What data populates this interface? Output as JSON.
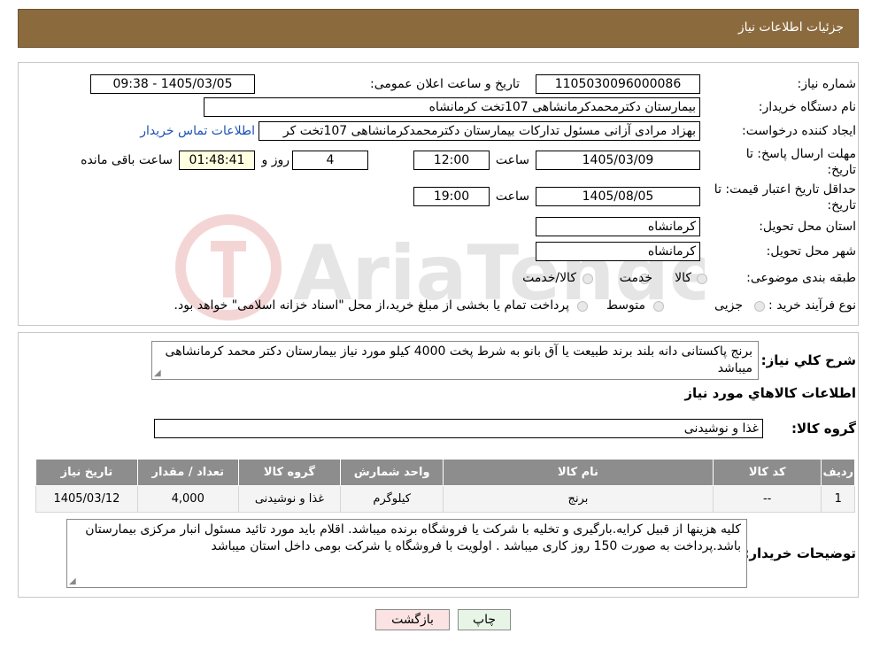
{
  "header": {
    "title": "جزئیات اطلاعات نیاز"
  },
  "form": {
    "need_number_label": "شماره نیاز:",
    "need_number": "1105030096000086",
    "announce_label": "تاریخ و ساعت اعلان عمومی:",
    "announce_value": "1405/03/05 - 09:38",
    "buyer_label": "نام دستگاه خریدار:",
    "buyer_value": "بیمارستان دکترمحمدکرمانشاهی 107تخت کرمانشاه",
    "creator_label": "ایجاد کننده درخواست:",
    "creator_value": "بهزاد مرادی آزانی مسئول تدارکات بیمارستان دکترمحمدکرمانشاهی 107تخت کر",
    "contact_link": "اطلاعات تماس خریدار",
    "deadline_label_1": "مهلت ارسال پاسخ: تا",
    "deadline_label_2": "تاریخ:",
    "deadline_date": "1405/03/09",
    "time_label": "ساعت",
    "deadline_time": "12:00",
    "days_value": "4",
    "days_label": "روز و",
    "remaining_time": "01:48:41",
    "remaining_label": "ساعت باقی مانده",
    "validity_label_1": "حداقل تاریخ اعتبار قیمت: تا",
    "validity_label_2": "تاریخ:",
    "validity_date": "1405/08/05",
    "validity_time": "19:00",
    "province_label": "استان محل تحویل:",
    "province_value": "کرمانشاه",
    "city_label": "شهر محل تحویل:",
    "city_value": "کرمانشاه",
    "category_label": "طبقه بندی موضوعی:",
    "category_options": [
      "کالا",
      "خدمت",
      "کالا/خدمت"
    ],
    "process_label": "نوع فرآیند خرید :",
    "process_options": [
      "جزیی",
      "متوسط"
    ],
    "process_note": "پرداخت تمام یا بخشی از مبلغ خرید،از محل \"اسناد خزانه اسلامی\" خواهد بود."
  },
  "summary": {
    "label": "شرح کلي نياز:",
    "text": "برنج پاکستانی دانه بلند برند طبیعت یا آق بانو به شرط پخت 4000 کیلو مورد نیاز بیمارستان دکتر محمد کرمانشاهی میباشد",
    "goods_info_title": "اطلاعات کالاهاي مورد نياز",
    "group_label": "گروه کالا:",
    "group_value": "غذا و نوشیدنی"
  },
  "table": {
    "headers": [
      "ردیف",
      "کد کالا",
      "نام کالا",
      "واحد شمارش",
      "گروه کالا",
      "تعداد / مقدار",
      "تاریخ نیاز"
    ],
    "rows": [
      [
        "1",
        "--",
        "برنج",
        "کیلوگرم",
        "غذا و نوشیدنی",
        "4,000",
        "1405/03/12"
      ]
    ]
  },
  "notes": {
    "label": "توضیحات خریدار:",
    "text": "کلیه هزینها از قبیل کرایه.بارگیری و تخلیه با شرکت یا فروشگاه برنده میباشد. اقلام باید مورد تائید مسئول انبار مرکزی بیمارستان باشد.پرداخت به صورت 150 روز کاری میباشد . اولویت با فروشگاه یا شرکت بومی داخل استان میباشد"
  },
  "buttons": {
    "print": "چاپ",
    "back": "بازگشت"
  },
  "watermark_text": "AriaTender.neT",
  "colors": {
    "header": "#8b6b3e",
    "table_header": "#8d8d8d",
    "back_button": "#fbe3e3",
    "print_button": "#e6f5e6"
  }
}
